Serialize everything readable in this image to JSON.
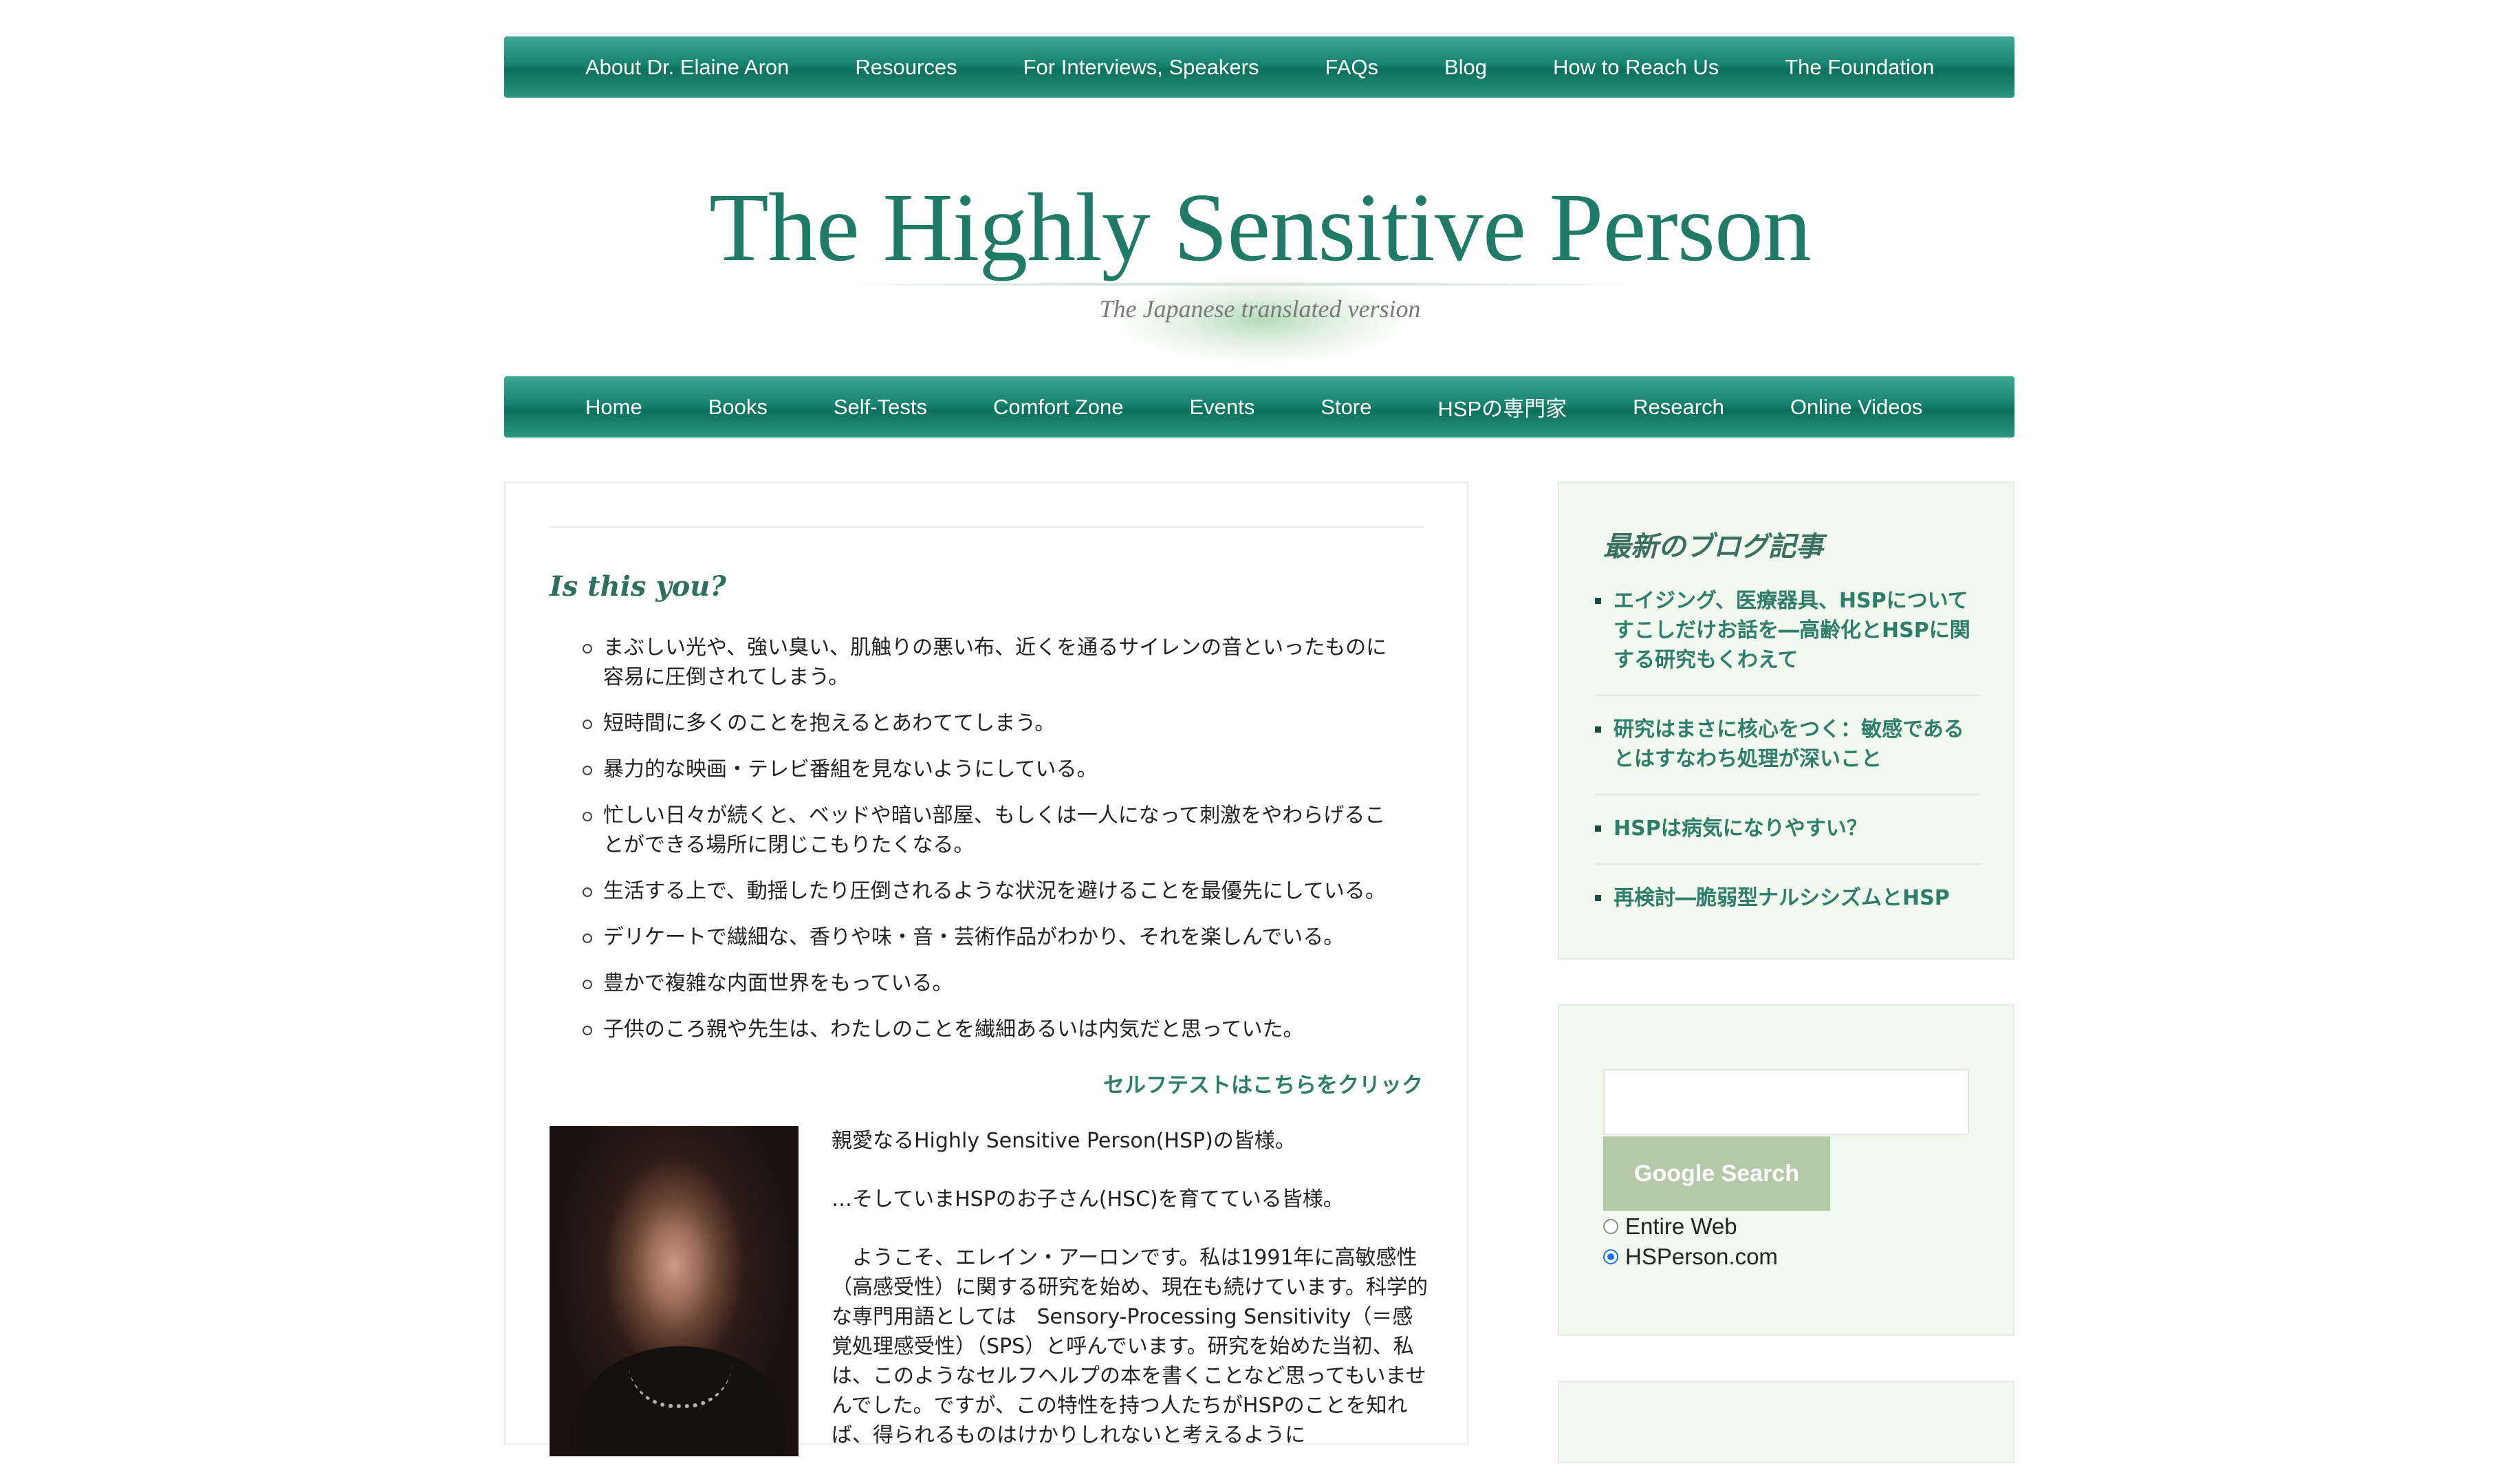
{
  "top_nav": [
    "About Dr. Elaine Aron",
    "Resources",
    "For Interviews, Speakers",
    "FAQs",
    "Blog",
    "How to Reach Us",
    "The Foundation"
  ],
  "header": {
    "title": "The Highly Sensitive Person",
    "subtitle": "The Japanese translated version"
  },
  "main_nav": [
    "Home",
    "Books",
    "Self-Tests",
    "Comfort Zone",
    "Events",
    "Store",
    "HSPの専門家",
    "Research",
    "Online Videos"
  ],
  "main": {
    "heading": "Is this you?",
    "checklist": [
      "まぶしい光や、強い臭い、肌触りの悪い布、近くを通るサイレンの音といったものに容易に圧倒されてしまう。",
      "短時間に多くのことを抱えるとあわててしまう。",
      "暴力的な映画・テレビ番組を見ないようにしている。",
      "忙しい日々が続くと、ベッドや暗い部屋、もしくは一人になって刺激をやわらげることができる場所に閉じこもりたくなる。",
      "生活する上で、動揺したり圧倒されるような状況を避けることを最優先にしている。",
      "デリケートで繊細な、香りや味・音・芸術作品がわかり、それを楽しんでいる。",
      "豊かで複雑な内面世界をもっている。",
      "子供のころ親や先生は、わたしのことを繊細あるいは内気だと思っていた。"
    ],
    "selftest_link": "セルフテストはこちらをクリック",
    "intro": [
      "親愛なるHighly Sensitive Person(HSP)の皆様。",
      "…そしていまHSPのお子さん(HSC)を育てている皆様。",
      "　ようこそ、エレイン・アーロンです。私は1991年に高敏感性（高感受性）に関する研究を始め、現在も続けています。科学的な専門用語としては　Sensory-Processing Sensitivity（＝感覚処理感受性）（SPS）と呼んでいます。研究を始めた当初、私は、このようなセルフヘルプの本を書くことなど思ってもいませんでした。ですが、この特性を持つ人たちがHSPのことを知れば、得られるものはけかりしれないと考えるように"
    ]
  },
  "sidebar": {
    "blog_title": "最新のブログ記事",
    "blog_posts": [
      "エイジング、医療器具、HSPについてすこしだけお話を―高齢化とHSPに関する研究もくわえて",
      "研究はまさに核心をつく：敏感であるとはすなわち処理が深いこと",
      "HSPは病気になりやすい？",
      "再検討―脆弱型ナルシシズムとHSP"
    ],
    "search": {
      "input_value": "",
      "button": "Google Search",
      "options": [
        "Entire Web",
        "HSPerson.com"
      ],
      "selected": "HSPerson.com"
    }
  },
  "colors": {
    "nav_green": "#168370",
    "title_green": "#1f7a66",
    "link_green": "#2e7d6b",
    "sidebar_bg": "#f1f9ef",
    "search_button": "#b4c9a7"
  }
}
